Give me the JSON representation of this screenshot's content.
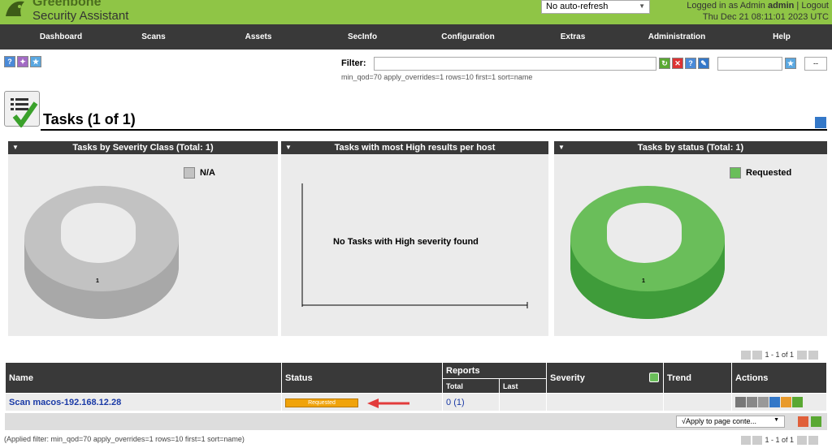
{
  "header": {
    "logo_line1": "Greenbone",
    "logo_line2": "Security Assistant",
    "refresh": "No auto-refresh",
    "logged_in_prefix": "Logged in as  Admin",
    "user": "admin",
    "logout": "Logout",
    "datetime": "Thu Dec 21 08:11:01 2023 UTC"
  },
  "nav": [
    "Dashboard",
    "Scans",
    "Assets",
    "SecInfo",
    "Configuration",
    "Extras",
    "Administration",
    "Help"
  ],
  "filter": {
    "label": "Filter:",
    "value": "",
    "applied_text": "min_qod=70 apply_overrides=1 rows=10 first=1 sort=name",
    "select": "--"
  },
  "page": {
    "title": "Tasks (1 of 1)"
  },
  "charts": {
    "severity": {
      "title": "Tasks by Severity Class (Total: 1)",
      "legend": "N/A",
      "value": "1"
    },
    "high": {
      "title": "Tasks with most High results per host",
      "message": "No Tasks with High severity found"
    },
    "status": {
      "title": "Tasks by status (Total: 1)",
      "legend": "Requested",
      "value": "1"
    }
  },
  "pager": "1 - 1 of 1",
  "table": {
    "headers": {
      "name": "Name",
      "status": "Status",
      "reports": "Reports",
      "total": "Total",
      "last": "Last",
      "severity": "Severity",
      "trend": "Trend",
      "actions": "Actions"
    },
    "row": {
      "name": "Scan macos-192.168.12.28",
      "status": "Requested",
      "reports_total": "0",
      "reports_in": "(1)"
    }
  },
  "apply": {
    "option": "√Apply to page conte..."
  },
  "applied_filter": "(Applied filter: min_qod=70 apply_overrides=1 rows=10 first=1 sort=name)",
  "colors": {
    "header_green": "#8fc546",
    "nav_dark": "#393939",
    "status_green": "#6abe5a",
    "na_gray": "#c2c2c2",
    "status_orange": "#f0a30a"
  }
}
